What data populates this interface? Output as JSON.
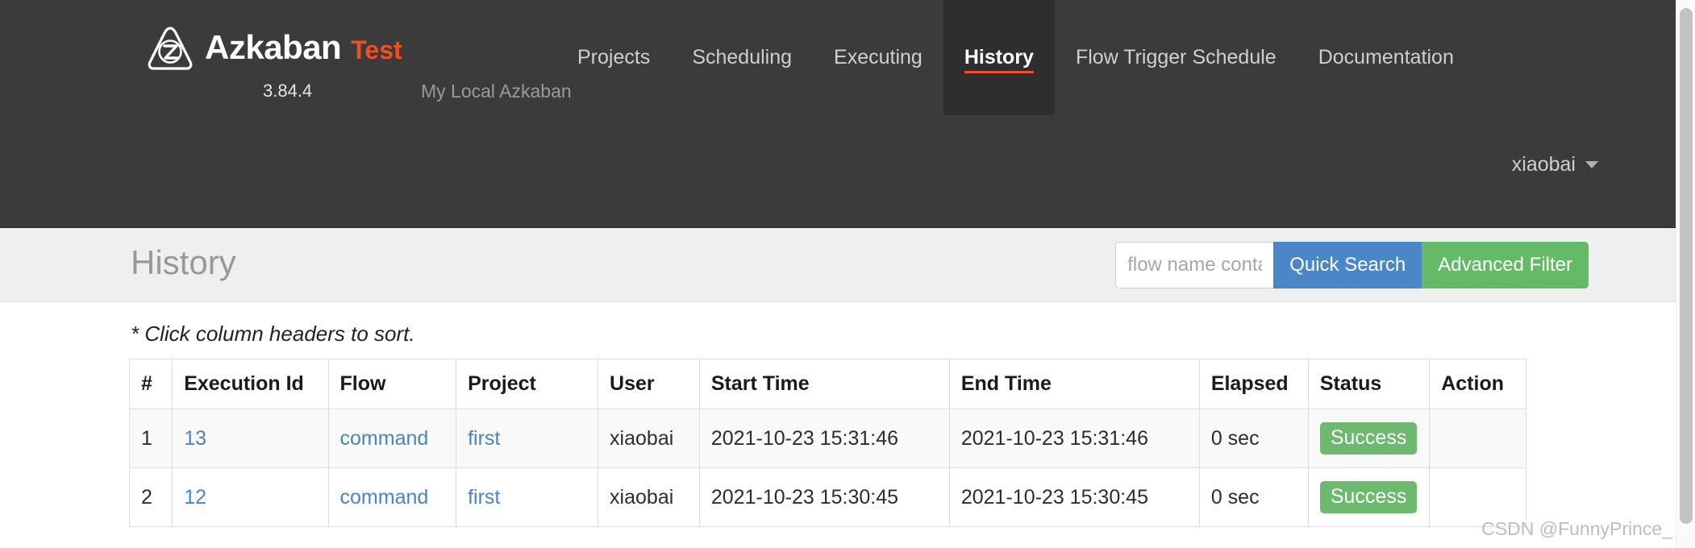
{
  "navbar": {
    "brand": {
      "logo_icon": "azkaban-logo-icon",
      "name": "Azkaban",
      "env_label": "Test",
      "version": "3.84.4",
      "subtitle": "My Local Azkaban"
    },
    "links": [
      {
        "label": "Projects",
        "active": false
      },
      {
        "label": "Scheduling",
        "active": false
      },
      {
        "label": "Executing",
        "active": false
      },
      {
        "label": "History",
        "active": true
      },
      {
        "label": "Flow Trigger Schedule",
        "active": false
      },
      {
        "label": "Documentation",
        "active": false
      }
    ],
    "user": {
      "name": "xiaobai",
      "caret_icon": "chevron-down-icon"
    }
  },
  "subheader": {
    "title": "History",
    "search": {
      "value": "",
      "placeholder": "flow name contains",
      "quick_search_label": "Quick Search",
      "advanced_filter_label": "Advanced Filter"
    }
  },
  "main": {
    "sort_note": "* Click column headers to sort.",
    "table": {
      "columns": [
        "#",
        "Execution Id",
        "Flow",
        "Project",
        "User",
        "Start Time",
        "End Time",
        "Elapsed",
        "Status",
        "Action"
      ],
      "rows": [
        {
          "num": "1",
          "execution_id": "13",
          "flow": "command",
          "project": "first",
          "user": "xiaobai",
          "start_time": "2021-10-23 15:31:46",
          "end_time": "2021-10-23 15:31:46",
          "elapsed": "0 sec",
          "status": "Success",
          "action": ""
        },
        {
          "num": "2",
          "execution_id": "12",
          "flow": "command",
          "project": "first",
          "user": "xiaobai",
          "start_time": "2021-10-23 15:30:45",
          "end_time": "2021-10-23 15:30:45",
          "elapsed": "0 sec",
          "status": "Success",
          "action": ""
        }
      ]
    }
  },
  "watermark": "CSDN @FunnyPrince_",
  "colors": {
    "navbar_bg": "#3b3b3b",
    "nav_active_bg": "#2e2e2e",
    "accent_orange": "#f04e23",
    "link_blue": "#4a82c4",
    "button_blue": "#4b87c6",
    "button_green": "#65ba68",
    "badge_green": "#6cb96f"
  }
}
